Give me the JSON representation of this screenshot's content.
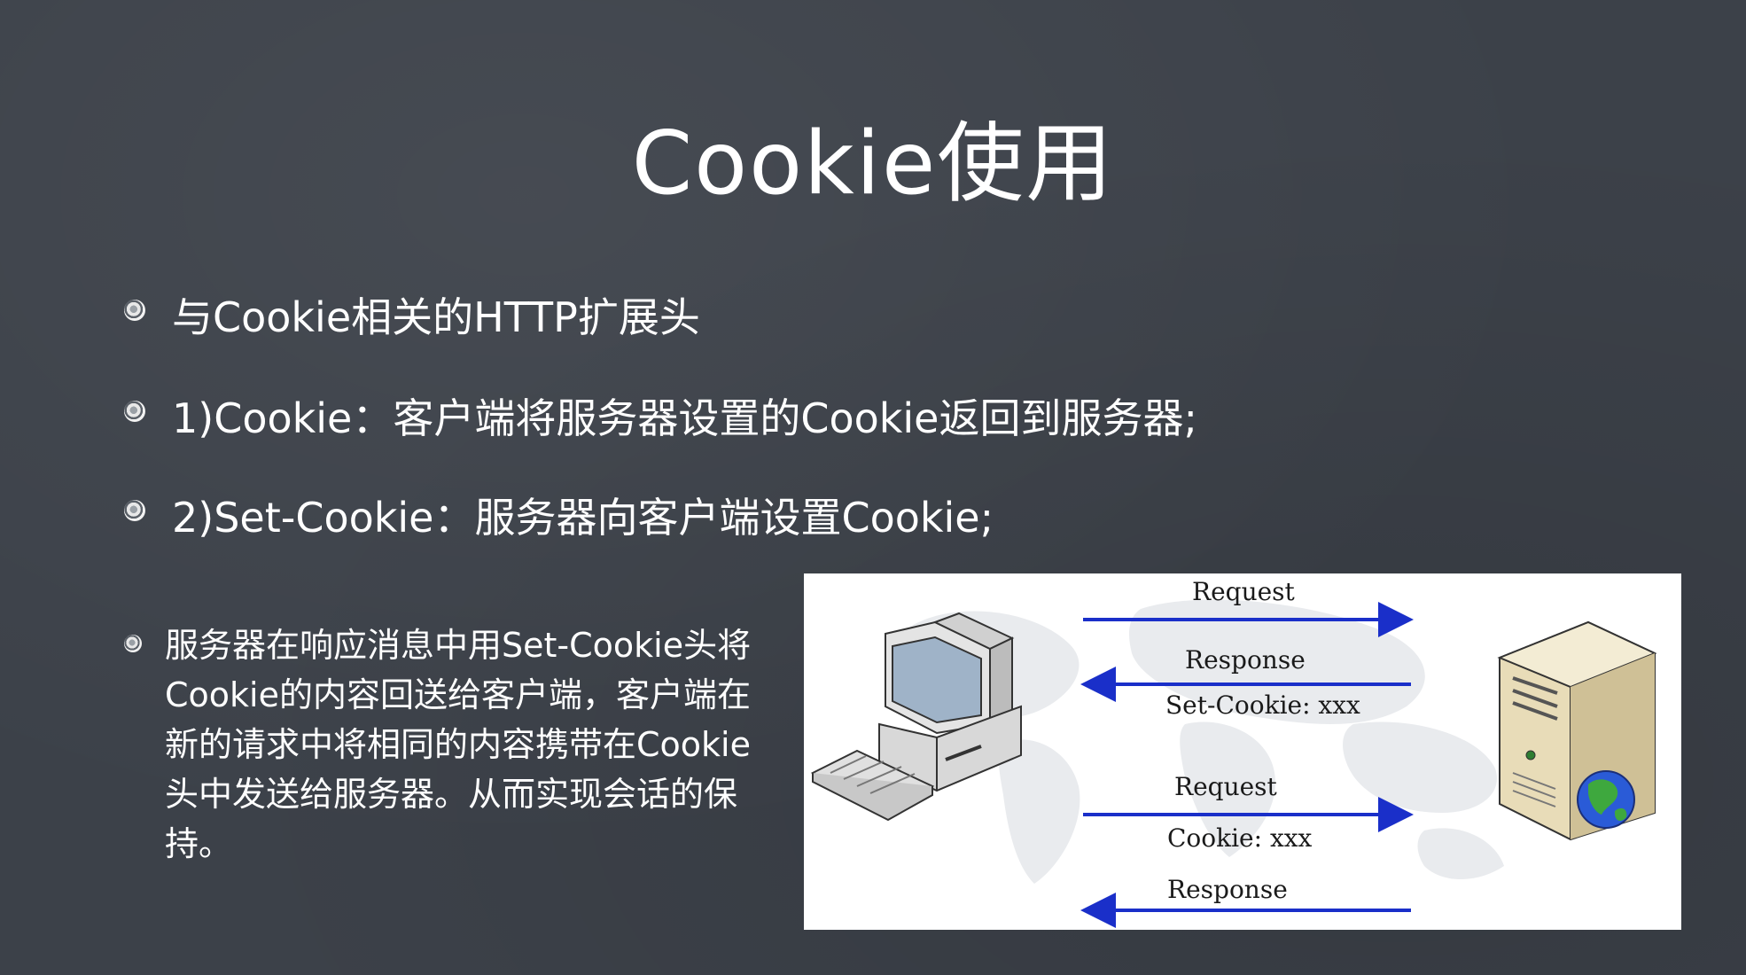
{
  "title": "Cookie使用",
  "bullets": [
    "与Cookie相关的HTTP扩展头",
    "1)Cookie：客户端将服务器设置的Cookie返回到服务器;",
    "2)Set-Cookie：服务器向客户端设置Cookie;",
    "服务器在响应消息中用Set-Cookie头将Cookie的内容回送给客户端，客户端在新的请求中将相同的内容携带在Cookie头中发送给服务器。从而实现会话的保持。"
  ],
  "diagram": {
    "labels": {
      "request1": "Request",
      "response1": "Response",
      "set_cookie": "Set-Cookie: xxx",
      "request2": "Request",
      "cookie": "Cookie: xxx",
      "response2": "Response"
    },
    "arrow_color": "#1a2fc9",
    "client_icon": "desktop-computer-icon",
    "server_icon": "server-tower-icon",
    "globe_icon": "globe-icon",
    "background_icon": "world-map-icon"
  }
}
